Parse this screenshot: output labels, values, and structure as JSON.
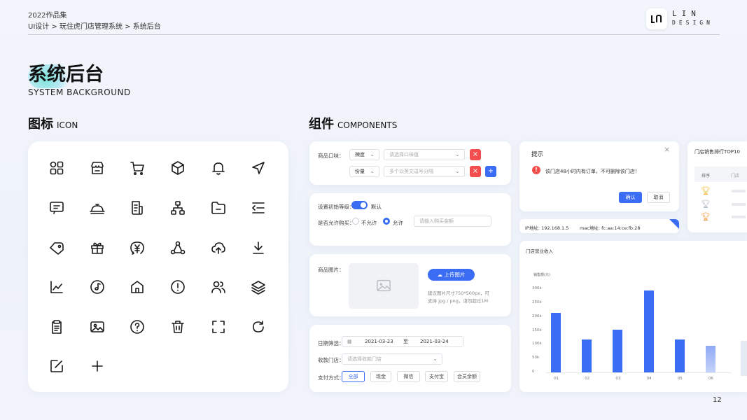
{
  "header": {
    "year_label": "2022作品集",
    "breadcrumb": "UI设计 > 玩住虎门店管理系统 > 系统后台"
  },
  "logo": {
    "line1": "LIN",
    "line2": "DESIGN"
  },
  "title": {
    "main": "系统后台",
    "sub": "SYSTEM BACKGROUND"
  },
  "sections": {
    "icons": {
      "cn": "图标",
      "en": "ICON"
    },
    "components": {
      "cn": "组件",
      "en": "COMPONENTS"
    }
  },
  "icons": [
    "grid-icon",
    "store-icon",
    "cart-icon",
    "box-icon",
    "bell-icon",
    "navigation-icon",
    "message-icon",
    "service-icon",
    "bill-icon",
    "org-chart-icon",
    "folder-icon",
    "menu-fold-icon",
    "tag-icon",
    "gift-icon",
    "yuan-icon",
    "share-icon",
    "upload-cloud-icon",
    "download-icon",
    "line-chart-icon",
    "music-icon",
    "home-icon",
    "alert-icon",
    "users-icon",
    "layers-icon",
    "clipboard-icon",
    "image-icon",
    "help-icon",
    "trash-icon",
    "scan-icon",
    "refresh-icon",
    "edit-icon",
    "plus-icon"
  ],
  "flavor": {
    "label": "商品口味：",
    "row1": {
      "sel": "辣度",
      "placeholder": "请选择口味值"
    },
    "row2": {
      "sel": "份量",
      "placeholder": "多个以英文逗号分隔"
    }
  },
  "settings": {
    "level_label": "设置初始等级：",
    "level_value": "默认",
    "buy_label": "是否允许购买：",
    "opt_no": "不允许",
    "opt_yes": "允许",
    "qty_placeholder": "请输入购买金额"
  },
  "image_upload": {
    "label": "商品图片：",
    "button": "上传图片",
    "tip1": "建议图片尺寸750*500px，可",
    "tip2": "支持 jpg / png，请勿超过1M"
  },
  "filter": {
    "date_label": "日期筛选：",
    "date_from": "2021-03-23",
    "to": "至",
    "date_to": "2021-03-24",
    "store_label": "收款门店：",
    "store_placeholder": "请选择收款门店",
    "pay_label": "支付方式：",
    "pay_options": [
      "全部",
      "现金",
      "微信",
      "支付宝",
      "会员余额"
    ]
  },
  "dialog": {
    "title": "提示",
    "message": "该门店48小时内有订单，不可删除该门店！",
    "confirm": "确认",
    "cancel": "取消"
  },
  "ipbar": {
    "ip": "IP地址: 192.168.1.5",
    "mac": "mac地址: fc:aa:14:ce:fb:28"
  },
  "ranking": {
    "title": "门店销售排行TOP10",
    "col_rank": "排序",
    "col_store": "门店"
  },
  "revenue": {
    "title": "门店营业收入",
    "ylabel": "销售额(元)"
  },
  "colors": {
    "accent": "#3a6cf4",
    "danger": "#f24e4e",
    "gold": "#f5b82e"
  },
  "chart_data": {
    "type": "bar",
    "title": "门店营业收入",
    "ylabel": "销售额(元)",
    "categories": [
      "01",
      "02",
      "03",
      "04",
      "05",
      "06"
    ],
    "values": [
      215,
      118,
      155,
      295,
      118,
      95
    ],
    "y_ticks": [
      "0",
      "50k",
      "100k",
      "150k",
      "200k",
      "250k",
      "300k"
    ],
    "ylim": [
      0,
      300
    ],
    "unit": "k"
  },
  "page_number": "12"
}
